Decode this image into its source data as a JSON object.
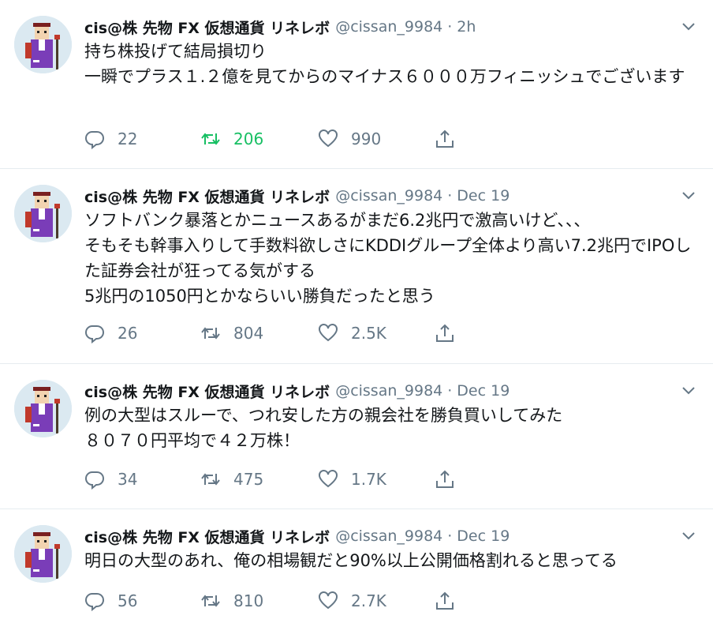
{
  "tweets": [
    {
      "name": "cis@株 先物 FX 仮想通貨 リネレボ",
      "handle": "@cissan_9984",
      "sep": "·",
      "time": "2h",
      "text": "持ち株投げて結局損切り\n一瞬でプラス１.２億を見てからのマイナス６０００万フィニッシュでございます",
      "replies": "22",
      "retweets": "206",
      "likes": "990",
      "retweeted": true
    },
    {
      "name": "cis@株 先物 FX 仮想通貨 リネレボ",
      "handle": "@cissan_9984",
      "sep": "·",
      "time": "Dec 19",
      "text": "ソフトバンク暴落とかニュースあるがまだ6.2兆円で激高いけど、、、\nそもそも幹事入りして手数料欲しさにKDDIグループ全体より高い7.2兆円でIPOした証券会社が狂ってる気がする\n5兆円の1050円とかならいい勝負だったと思う",
      "replies": "26",
      "retweets": "804",
      "likes": "2.5K",
      "retweeted": false
    },
    {
      "name": "cis@株 先物 FX 仮想通貨 リネレボ",
      "handle": "@cissan_9984",
      "sep": "·",
      "time": "Dec 19",
      "text": "例の大型はスルーで、つれ安した方の親会社を勝負買いしてみた\n８０７０円平均で４２万株！",
      "replies": "34",
      "retweets": "475",
      "likes": "1.7K",
      "retweeted": false
    },
    {
      "name": "cis@株 先物 FX 仮想通貨 リネレボ",
      "handle": "@cissan_9984",
      "sep": "·",
      "time": "Dec 19",
      "text": "明日の大型のあれ、俺の相場観だと90%以上公開価格割れると思ってる",
      "replies": "56",
      "retweets": "810",
      "likes": "2.7K",
      "retweeted": false
    }
  ],
  "colors": {
    "retweet_active": "#17bf63",
    "icon_gray": "#657786",
    "divider": "#e6ecf0"
  },
  "icons": [
    "reply-icon",
    "retweet-icon",
    "like-icon",
    "share-icon",
    "chevron-down-icon"
  ]
}
